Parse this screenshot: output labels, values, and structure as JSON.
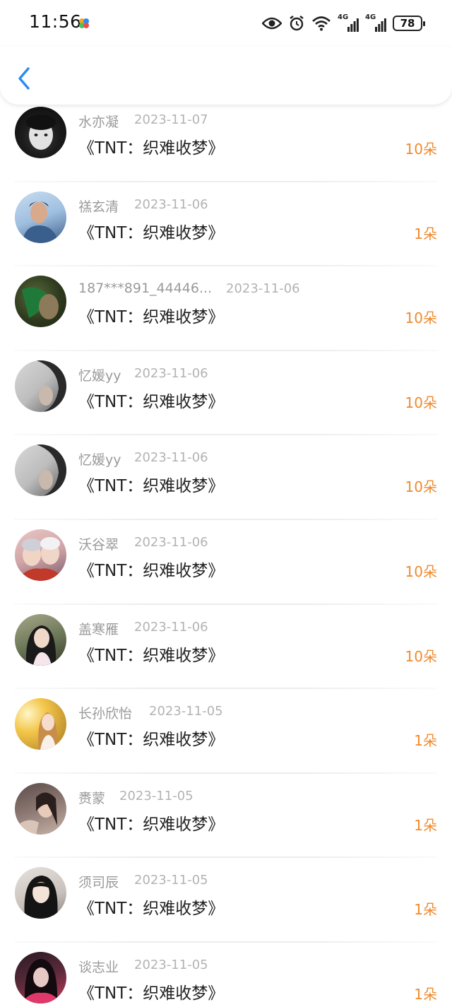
{
  "status_bar": {
    "time": "11:56",
    "signal1": "4G",
    "signal2": "4G",
    "battery": "78"
  },
  "header": {
    "back_icon": "chevron-left-icon",
    "accent": "#2a8bf2"
  },
  "list": {
    "count_color": "#f08a2c",
    "items": [
      {
        "name": "水亦凝",
        "date": "2023-11-07",
        "title": "《TNT：织难收梦》",
        "count": "10朵"
      },
      {
        "name": "禚玄清",
        "date": "2023-11-06",
        "title": "《TNT：织难收梦》",
        "count": "1朵"
      },
      {
        "name": "187***891_44446...",
        "date": "2023-11-06",
        "title": "《TNT：织难收梦》",
        "count": "10朵"
      },
      {
        "name": "忆媛yy",
        "date": "2023-11-06",
        "title": "《TNT：织难收梦》",
        "count": "10朵"
      },
      {
        "name": "忆媛yy",
        "date": "2023-11-06",
        "title": "《TNT：织难收梦》",
        "count": "10朵"
      },
      {
        "name": "沃谷翠",
        "date": "2023-11-06",
        "title": "《TNT：织难收梦》",
        "count": "10朵"
      },
      {
        "name": "盖寒雁",
        "date": "2023-11-06",
        "title": "《TNT：织难收梦》",
        "count": "10朵"
      },
      {
        "name": "长孙欣怡",
        "date": "2023-11-05",
        "title": "《TNT：织难收梦》",
        "count": "1朵"
      },
      {
        "name": "赉蒙",
        "date": "2023-11-05",
        "title": "《TNT：织难收梦》",
        "count": "1朵"
      },
      {
        "name": "须司辰",
        "date": "2023-11-05",
        "title": "《TNT：织难收梦》",
        "count": "1朵"
      },
      {
        "name": "谈志业",
        "date": "2023-11-05",
        "title": "《TNT：织难收梦》",
        "count": "1朵"
      }
    ]
  }
}
